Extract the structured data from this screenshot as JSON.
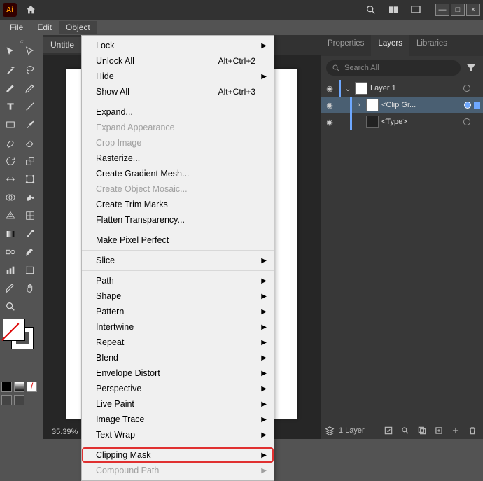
{
  "app": {
    "logo": "Ai"
  },
  "menubar": {
    "items": [
      "File",
      "Edit",
      "Object"
    ],
    "active_index": 2
  },
  "doc": {
    "tab": "Untitle",
    "zoom": "35.39%"
  },
  "panel": {
    "tabs": [
      "Properties",
      "Layers",
      "Libraries"
    ],
    "active_index": 1,
    "search_placeholder": "Search All",
    "layers": [
      {
        "name": "Layer 1",
        "expanded": true,
        "selected": false,
        "indent": 0
      },
      {
        "name": "<Clip Gr...",
        "expanded": false,
        "selected": true,
        "indent": 1
      },
      {
        "name": "<Type>",
        "expanded": false,
        "selected": false,
        "indent": 1
      }
    ],
    "footer_count": "1 Layer"
  },
  "menu": {
    "groups": [
      [
        {
          "label": "Lock",
          "submenu": true
        },
        {
          "label": "Unlock All",
          "shortcut": "Alt+Ctrl+2"
        },
        {
          "label": "Hide",
          "submenu": true
        },
        {
          "label": "Show All",
          "shortcut": "Alt+Ctrl+3"
        }
      ],
      [
        {
          "label": "Expand..."
        },
        {
          "label": "Expand Appearance",
          "disabled": true
        },
        {
          "label": "Crop Image",
          "disabled": true
        },
        {
          "label": "Rasterize..."
        },
        {
          "label": "Create Gradient Mesh..."
        },
        {
          "label": "Create Object Mosaic...",
          "disabled": true
        },
        {
          "label": "Create Trim Marks"
        },
        {
          "label": "Flatten Transparency..."
        }
      ],
      [
        {
          "label": "Make Pixel Perfect"
        }
      ],
      [
        {
          "label": "Slice",
          "submenu": true
        }
      ],
      [
        {
          "label": "Path",
          "submenu": true
        },
        {
          "label": "Shape",
          "submenu": true
        },
        {
          "label": "Pattern",
          "submenu": true
        },
        {
          "label": "Intertwine",
          "submenu": true
        },
        {
          "label": "Repeat",
          "submenu": true
        },
        {
          "label": "Blend",
          "submenu": true
        },
        {
          "label": "Envelope Distort",
          "submenu": true
        },
        {
          "label": "Perspective",
          "submenu": true
        },
        {
          "label": "Live Paint",
          "submenu": true
        },
        {
          "label": "Image Trace",
          "submenu": true
        },
        {
          "label": "Text Wrap",
          "submenu": true
        }
      ],
      [
        {
          "label": "Clipping Mask",
          "submenu": true,
          "highlighted": true
        },
        {
          "label": "Compound Path",
          "submenu": true,
          "disabled": true
        }
      ]
    ]
  }
}
